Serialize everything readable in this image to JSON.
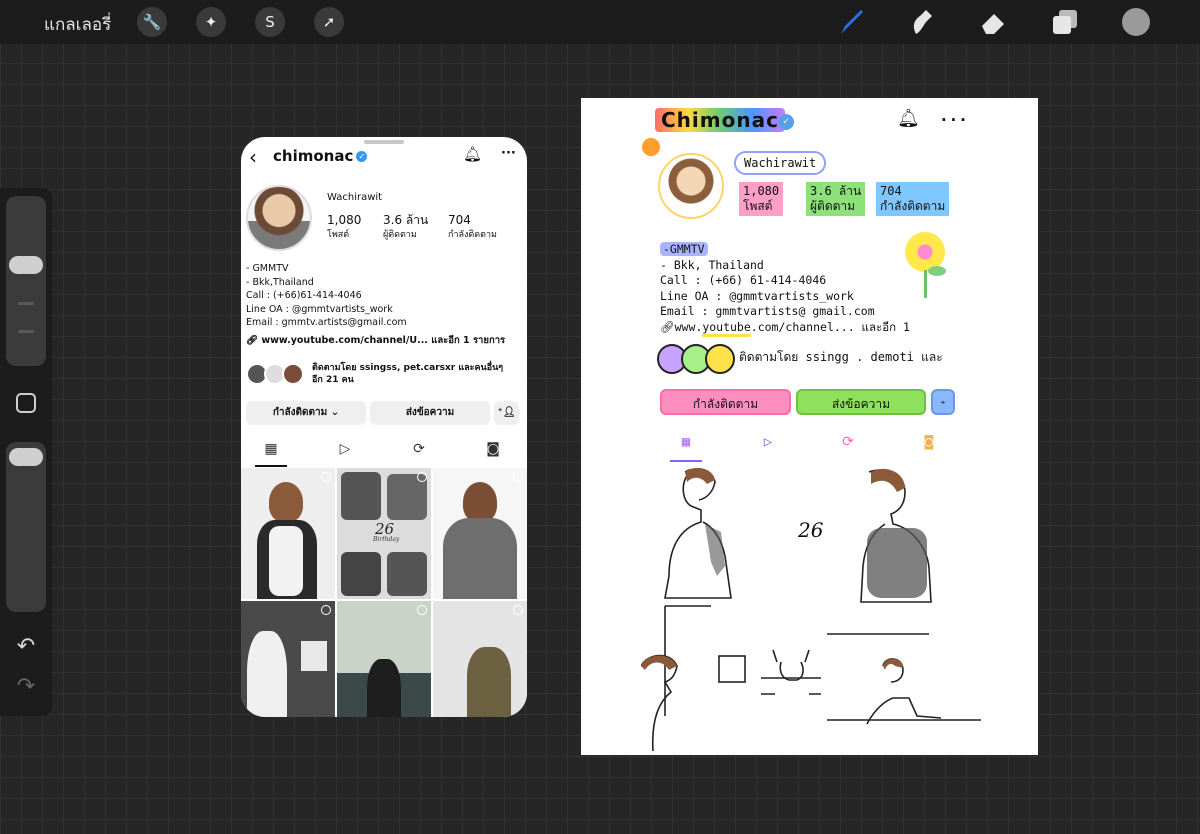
{
  "app": {
    "gallery_label": "แกลเลอรี่",
    "accent": "#2f6fe8"
  },
  "toolbar": {
    "left_tools": [
      "wrench-icon",
      "magic-wand-icon",
      "selection-icon",
      "arrow-icon"
    ],
    "right_tools": [
      "brush-icon",
      "smudge-icon",
      "eraser-icon",
      "layers-icon"
    ],
    "color": "#9a9a9a"
  },
  "ref": {
    "username": "chimonac",
    "full_name": "Wachirawit",
    "stats": [
      {
        "value": "1,080",
        "label": "โพสต์"
      },
      {
        "value": "3.6 ล้าน",
        "label": "ผู้ติดตาม"
      },
      {
        "value": "704",
        "label": "กำลังติดตาม"
      }
    ],
    "bio": [
      "- GMMTV",
      "- Bkk,Thailand",
      "Call : (+66)61-414-4046",
      "Line OA : @gmmtvartists_work",
      "Email : gmmtv.artists@gmail.com"
    ],
    "link": "www.youtube.com/channel/U... และอีก 1 รายการ",
    "followed_by_line1": "ติดตามโดย ssingss, pet.carsxr และคนอื่นๆ",
    "followed_by_line2": "อีก 21 คน",
    "following_btn": "กำลังติดตาม",
    "message_btn": "ส่งข้อความ",
    "grid_text": "26",
    "grid_subtext": "Birthday"
  },
  "drawing": {
    "username": "Chimonac",
    "full_name": "Wachirawit",
    "stats": [
      {
        "value": "1,080",
        "label": "โพสต์",
        "color": "#ff9ec7"
      },
      {
        "value": "3.6 ล้าน",
        "label": "ผู้ติดตาม",
        "color": "#8ee07a"
      },
      {
        "value": "704",
        "label": "กำลังติดตาม",
        "color": "#7ec8ff"
      }
    ],
    "tag": "-GMMTV",
    "bio": [
      "- Bkk, Thailand",
      "Call : (+66) 61-414-4046",
      "Line OA : @gmmtvartists_work",
      "Email : gmmtvartists@ gmail.com"
    ],
    "link_prefix": "www.",
    "link_highlight": "youtube",
    ".link_suffix": "",
    "link_suffix": ".com/channel... และอีก 1",
    "followed_by": "ติดตามโดย ssingg . demoti และ",
    "following_btn": "กำลังติดตาม",
    "message_btn": "ส่งข้อความ",
    "circle_colors": [
      "#c8a2ff",
      "#a6f08a",
      "#ffe14a"
    ],
    "btn_colors": {
      "following": "#ff8ec0",
      "message": "#8fe05a",
      "add": "#8ab8ff"
    },
    "grid_text": "26"
  }
}
